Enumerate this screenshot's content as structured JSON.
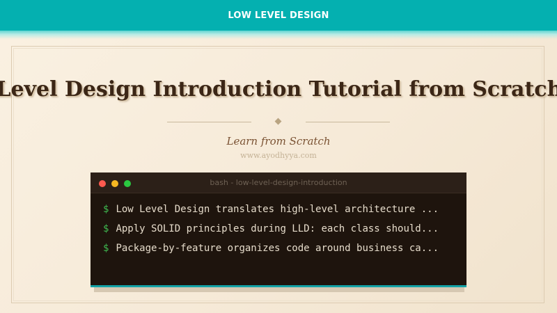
{
  "header": {
    "title": "LOW LEVEL DESIGN"
  },
  "main": {
    "headline": "Low Level Design Introduction Tutorial from Scratch",
    "subtitle": "Learn from Scratch",
    "website": "www.ayodhyya.com"
  },
  "terminal": {
    "window_title": "bash - low-level-design-introduction",
    "prompt_symbol": "$",
    "lines": [
      "Low Level Design translates high-level architecture ...",
      "Apply SOLID principles during LLD: each class should...",
      "Package-by-feature organizes code around business ca..."
    ]
  },
  "colors": {
    "header_bg": "#04b0b0",
    "page_bg": "#f6ead8",
    "terminal_bg": "#1e140d",
    "prompt_green": "#3fb950",
    "accent_teal": "#13a3a7"
  }
}
